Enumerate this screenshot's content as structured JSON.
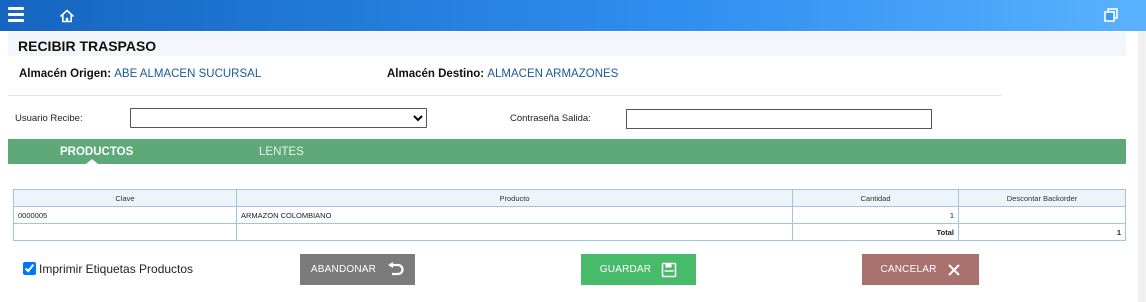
{
  "header": {
    "menu_icon": "hamburger-icon",
    "home_icon": "home-icon",
    "restore_icon": "restore-window-icon"
  },
  "page": {
    "title": "RECIBIR TRASPASO"
  },
  "info": {
    "origin_label": "Almacén Origen:",
    "origin_value": "ABE ALMACEN SUCURSAL",
    "dest_label": "Almacén Destino:",
    "dest_value": "ALMACEN ARMAZONES"
  },
  "form": {
    "user_label": "Usuario Recibe:",
    "user_value": "",
    "password_label": "Contraseña Salida:",
    "password_value": ""
  },
  "tabs": [
    {
      "label": "PRODUCTOS",
      "active": true
    },
    {
      "label": "LENTES",
      "active": false
    }
  ],
  "table": {
    "columns": [
      "Clave",
      "Producto",
      "Cantidad",
      "Descontar Backorder"
    ],
    "rows": [
      {
        "clave": "0000005",
        "producto": "ARMAZON COLOMBIANO",
        "cantidad": "1",
        "backorder": ""
      }
    ],
    "total_label": "Total",
    "total_value": "1"
  },
  "footer": {
    "print_checked": true,
    "print_label": "Imprimir Etiquetas Productos",
    "abandonar_label": "ABANDONAR",
    "guardar_label": "GUARDAR",
    "cancelar_label": "CANCELAR"
  },
  "colors": {
    "header_gradient_start": "#1565c0",
    "header_gradient_end": "#5ab2ff",
    "tabbar": "#5fa878",
    "abandonar": "#7b7b7b",
    "guardar": "#48bb6a",
    "cancelar": "#a8716d",
    "info_value": "#1a5a96"
  }
}
